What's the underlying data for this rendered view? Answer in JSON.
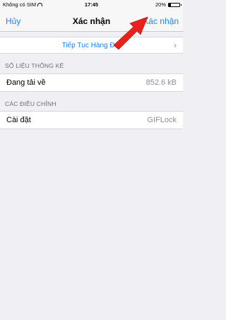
{
  "status_bar": {
    "carrier": "Không có SIM",
    "time": "17:45",
    "battery": "20%",
    "battery_level": 0.2
  },
  "nav": {
    "left_label": "Hủy",
    "title": "Xác nhận",
    "right_label": "Xác nhận"
  },
  "continue_row": {
    "label": "Tiếp Tục Hàng Đợi"
  },
  "stats_section": {
    "header": "SỐ LIỆU THỐNG KÊ",
    "row_label": "Đang tải về",
    "row_value": "852.6 kB"
  },
  "adjust_section": {
    "header": "CÁC ĐIỀU CHỈNH",
    "row_label": "Cài đặt",
    "row_value": "GIFLock"
  },
  "annotation": {
    "arrow_color": "#e8211c"
  },
  "colors": {
    "accent": "#1a82fb",
    "background": "#efeff4"
  }
}
